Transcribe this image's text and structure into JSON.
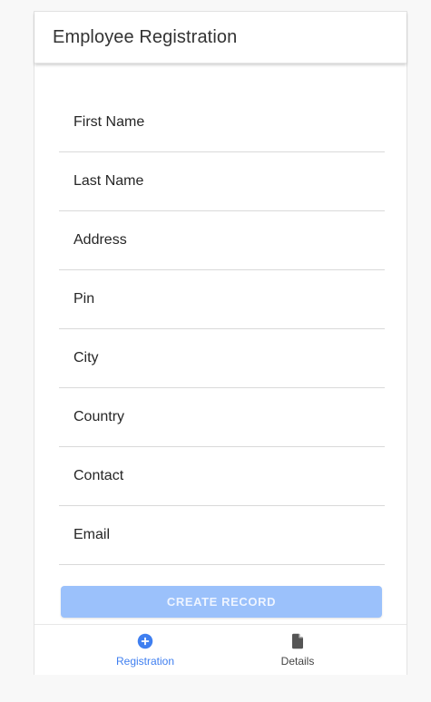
{
  "header": {
    "title": "Employee Registration"
  },
  "form": {
    "fields": [
      {
        "label": "First Name"
      },
      {
        "label": "Last Name"
      },
      {
        "label": "Address"
      },
      {
        "label": "Pin"
      },
      {
        "label": "City"
      },
      {
        "label": "Country"
      },
      {
        "label": "Contact"
      },
      {
        "label": "Email"
      }
    ],
    "submit_label": "CREATE RECORD"
  },
  "bottom_nav": {
    "items": [
      {
        "label": "Registration",
        "icon": "add-circle-icon",
        "active": true
      },
      {
        "label": "Details",
        "icon": "document-icon",
        "active": false
      }
    ]
  },
  "colors": {
    "accent": "#3f7ff0",
    "button_disabled": "#9bc1fb",
    "inactive": "#555555"
  }
}
